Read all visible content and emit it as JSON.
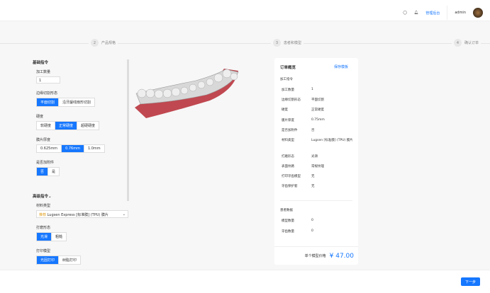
{
  "header": {
    "admin_link": "管理后台",
    "username": "admin"
  },
  "steps": [
    {
      "num": "2",
      "label": "产品规格"
    },
    {
      "num": "3",
      "label": "患者和模型"
    },
    {
      "num": "4",
      "label": "确认订单"
    }
  ],
  "left": {
    "basic_title": "基础指令",
    "qty_label": "加工数量",
    "qty_value": "1",
    "edge_label": "边缘切割形态",
    "edge_options": [
      "平面切割",
      "沿牙龈线扇形切割"
    ],
    "hard_label": "硬度",
    "hard_options": [
      "软硬度",
      "正常硬度",
      "超硬硬度"
    ],
    "thick_label": "膜片厚度",
    "thick_options": [
      "0.625mm",
      "0.76mm",
      "1.0mm"
    ],
    "attach_label": "是否加附件",
    "attach_options": [
      "否",
      "是"
    ],
    "adv_title": "高级指令",
    "mat_label": "材料类型",
    "mat_tag": "推荐",
    "mat_value": "Lugsen Express [标准膜] (TPU) 膜片",
    "trim_label": "打磨形态",
    "trim_options": [
      "光滑",
      "粗糙"
    ],
    "print_label": "打印模型",
    "print_options": [
      "光固打印",
      "树脂打印"
    ]
  },
  "summary": {
    "title": "订单概览",
    "save": "保存模板",
    "section1": "加工指令",
    "rows": [
      {
        "k": "加工数量",
        "v": "1"
      },
      {
        "k": "边缘切割形态",
        "v": "平面切割"
      },
      {
        "k": "硬度",
        "v": "正常硬度"
      },
      {
        "k": "膜片厚度",
        "v": "0.75mm"
      },
      {
        "k": "是否加附件",
        "v": "否"
      },
      {
        "k": "材料类型",
        "v": "Lugsen [标准膜] (TPU) 膜片"
      },
      {
        "k": "打磨形态",
        "v": "光滑"
      },
      {
        "k": "表面纹路",
        "v": "常规纹理"
      },
      {
        "k": "打印牙齿模型",
        "v": "无"
      },
      {
        "k": "牙齿保护套",
        "v": "无"
      }
    ],
    "section2": "患者数据",
    "rows2": [
      {
        "k": "模型数量",
        "v": "0"
      },
      {
        "k": "牙齿数量",
        "v": "0"
      }
    ],
    "price_label": "单个模型价格",
    "price": "¥ 47.00"
  },
  "footer": {
    "next": "下一步"
  }
}
